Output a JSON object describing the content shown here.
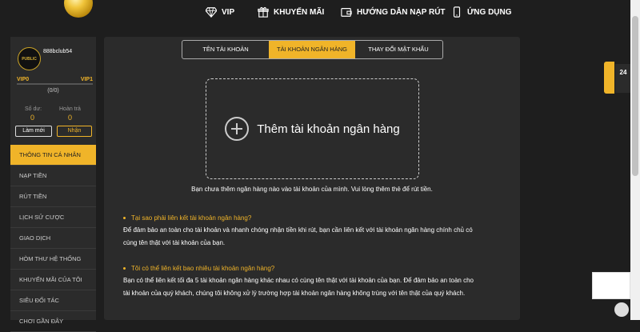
{
  "nav": {
    "vip": "VIP",
    "promo": "KHUYẾN MÃI",
    "guide": "HƯỚNG DẪN NẠP RÚT",
    "app": "ỨNG DỤNG"
  },
  "sidebar": {
    "avatar_text": "PUBLIC",
    "username": "888bclub54",
    "vip_current": "VIP0",
    "vip_next": "VIP1",
    "progress": "(0/0)",
    "progress_fraction": 0,
    "balance_label": "Số dư:",
    "balance_value": "0",
    "rebate_label": "Hoàn trả",
    "rebate_value": "0",
    "refresh_button": "Làm mới",
    "receive_button": "Nhận",
    "menu": [
      "THÔNG TIN CÁ NHÂN",
      "NẠP TIỀN",
      "RÚT TIỀN",
      "LỊCH SỬ CƯỢC",
      "GIAO DỊCH",
      "HÒM THƯ HỆ THỐNG",
      "KHUYẾN MÃI CỦA TÔI",
      "SIÊU ĐỐI TÁC",
      "CHƠI GẦN ĐÂY"
    ]
  },
  "tabs": [
    "TÊN TÀI KHOẢN",
    "TÀI KHOẢN NGÂN HÀNG",
    "THAY ĐỔI MẬT KHẨU"
  ],
  "main": {
    "add_bank": "Thêm tài khoản ngân hàng",
    "notice": "Bạn chưa thêm ngân hàng nào vào tài khoản của mình. Vui lòng thêm thẻ để rút tiền.",
    "q1": "Tại sao phải liên kết tài khoản ngân hàng?",
    "a1_line1": "Để đảm bảo an toàn cho tài khoản và nhanh chóng nhận tiền khi rút, bạn cần liên kết với tài khoản ngân hàng chính chủ có",
    "a1_line2": "cùng tên thật với tài khoản của bạn.",
    "q2": "Tôi có thể liên kết bao nhiêu tài khoản ngân hàng?",
    "a2_line1": "Bạn có thể liên kết tối đa 5 tài khoản ngân hàng khác nhau có cùng tên thật với tài khoản của bạn. Để đảm bảo an toàn cho",
    "a2_line2": "tài khoản của quý khách, chúng tôi không xử lý trường hợp tài khoản ngân hàng không trùng với tên thật của quý khách."
  },
  "side": {
    "support": "24"
  },
  "colors": {
    "accent": "#f0b429",
    "background": "#1e1e1e",
    "panel": "#2b2b2b"
  }
}
